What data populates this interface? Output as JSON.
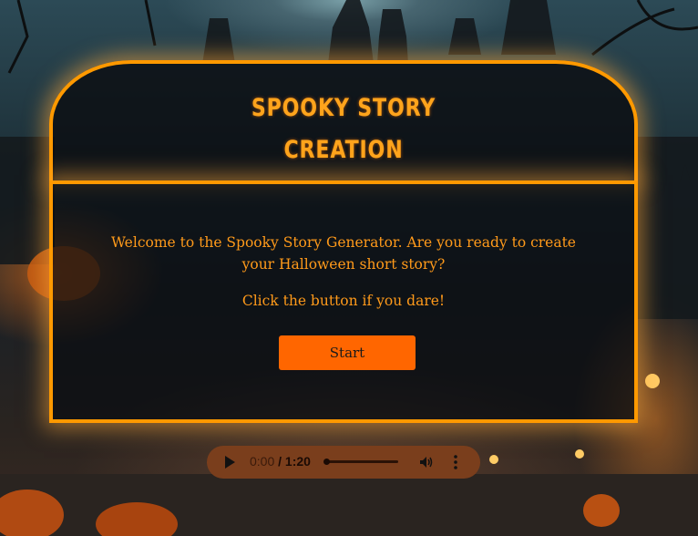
{
  "page": {
    "title_line1": "SPOOKY STORY",
    "title_line2": "CREATION",
    "welcome_text": "Welcome to the Spooky Story Generator. Are you ready to create your Halloween short story?",
    "dare_text": "Click the button if you dare!",
    "start_label": "Start"
  },
  "audio": {
    "current_time": "0:00",
    "separator": " / ",
    "duration": "1:20",
    "progress": 0,
    "icons": [
      "play-icon",
      "volume-icon",
      "more-options-icon"
    ]
  },
  "colors": {
    "accent": "#ff9900",
    "button": "#ff6600",
    "text": "#ff9a1a"
  }
}
